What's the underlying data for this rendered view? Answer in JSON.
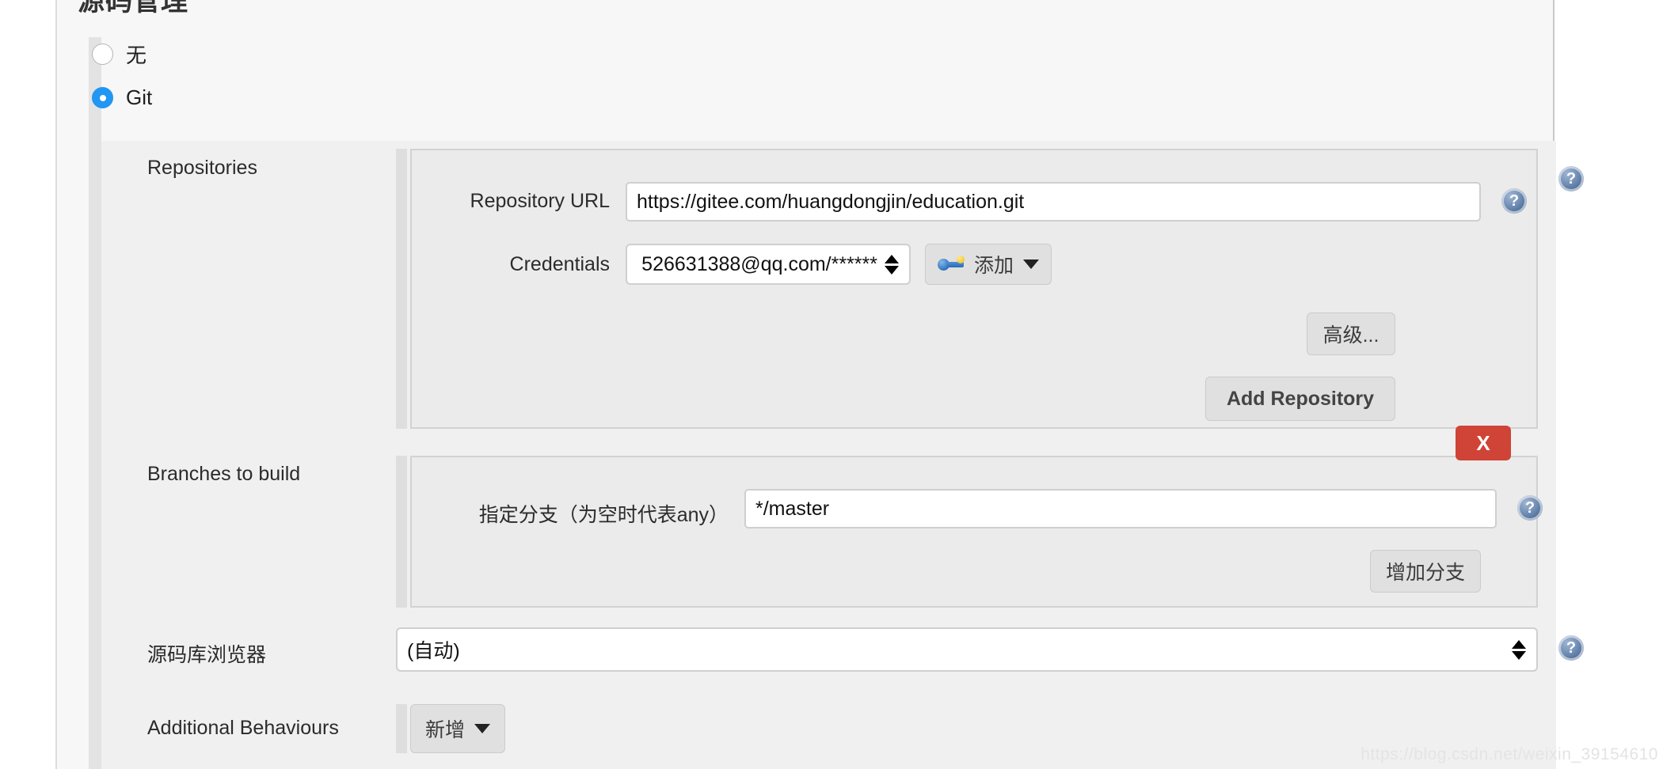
{
  "section": {
    "title": "源码管理"
  },
  "scm_options": [
    {
      "label": "无",
      "selected": false
    },
    {
      "label": "Git",
      "selected": true
    }
  ],
  "repositories": {
    "label": "Repositories",
    "repository_url": {
      "label": "Repository URL",
      "value": "https://gitee.com/huangdongjin/education.git"
    },
    "credentials": {
      "label": "Credentials",
      "value": "526631388@qq.com/******",
      "add_button": "添加"
    },
    "advanced_button": "高级...",
    "add_repository_button": "Add Repository"
  },
  "branches": {
    "label": "Branches to build",
    "branch_specifier": {
      "label": "指定分支（为空时代表any）",
      "value": "*/master"
    },
    "delete_button": "X",
    "add_branch_button": "增加分支"
  },
  "repository_browser": {
    "label": "源码库浏览器",
    "value": "(自动)"
  },
  "additional_behaviours": {
    "label": "Additional Behaviours",
    "add_button": "新增"
  },
  "help_icon_label": "?",
  "watermark": "https://blog.csdn.net/weixin_39154610",
  "colors": {
    "accent": "#2196f3",
    "delete": "#cf4436",
    "panel_bg": "#f0f0f0",
    "block_bg": "#ebebeb"
  }
}
